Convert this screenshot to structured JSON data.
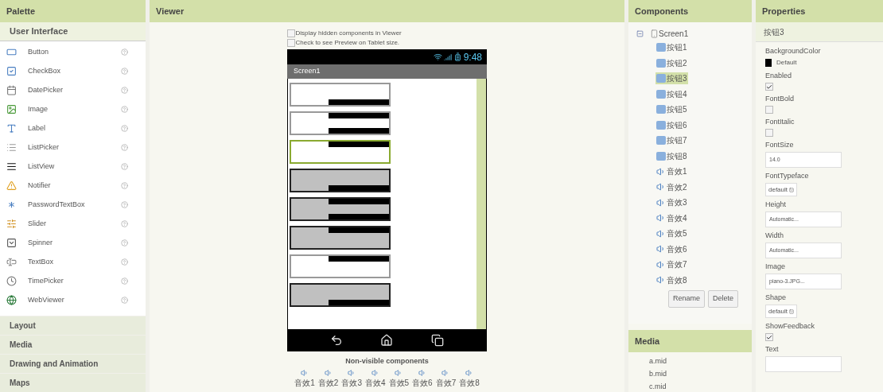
{
  "palette": {
    "title": "Palette",
    "open_section": "User Interface",
    "items": [
      {
        "label": "Button"
      },
      {
        "label": "CheckBox"
      },
      {
        "label": "DatePicker"
      },
      {
        "label": "Image"
      },
      {
        "label": "Label"
      },
      {
        "label": "ListPicker"
      },
      {
        "label": "ListView"
      },
      {
        "label": "Notifier"
      },
      {
        "label": "PasswordTextBox"
      },
      {
        "label": "Slider"
      },
      {
        "label": "Spinner"
      },
      {
        "label": "TextBox"
      },
      {
        "label": "TimePicker"
      },
      {
        "label": "WebViewer"
      }
    ],
    "sections": [
      "Layout",
      "Media",
      "Drawing and Animation",
      "Maps"
    ]
  },
  "viewer": {
    "title": "Viewer",
    "options": [
      {
        "label": "Display hidden components in Viewer",
        "checked": false
      },
      {
        "label": "Check to see Preview on Tablet size.",
        "checked": false
      }
    ],
    "phone": {
      "time": "9:48",
      "screen_title": "Screen1",
      "keys": [
        {
          "kind": "white",
          "top_bar": false,
          "bottom_bar": true,
          "selected": false
        },
        {
          "kind": "white",
          "top_bar": true,
          "bottom_bar": true,
          "selected": false
        },
        {
          "kind": "white",
          "top_bar": true,
          "bottom_bar": false,
          "selected": true
        },
        {
          "kind": "gray",
          "top_bar": false,
          "bottom_bar": true,
          "selected": false
        },
        {
          "kind": "gray",
          "top_bar": true,
          "bottom_bar": true,
          "selected": false
        },
        {
          "kind": "gray",
          "top_bar": true,
          "bottom_bar": false,
          "selected": false
        },
        {
          "kind": "white",
          "top_bar": true,
          "bottom_bar": false,
          "selected": false
        },
        {
          "kind": "gray",
          "top_bar": false,
          "bottom_bar": true,
          "selected": false
        }
      ]
    },
    "nonvisible_title": "Non-visible components",
    "nonvisible": [
      "音效1",
      "音效2",
      "音效3",
      "音效4",
      "音效5",
      "音效6",
      "音效7",
      "音效8"
    ]
  },
  "components": {
    "title": "Components",
    "root": {
      "label": "Screen1",
      "expanded": true,
      "children": [
        {
          "kind": "button",
          "label": "按钮1",
          "selected": false
        },
        {
          "kind": "button",
          "label": "按钮2",
          "selected": false
        },
        {
          "kind": "button",
          "label": "按钮3",
          "selected": true
        },
        {
          "kind": "button",
          "label": "按钮4",
          "selected": false
        },
        {
          "kind": "button",
          "label": "按钮5",
          "selected": false
        },
        {
          "kind": "button",
          "label": "按钮6",
          "selected": false
        },
        {
          "kind": "button",
          "label": "按钮7",
          "selected": false
        },
        {
          "kind": "button",
          "label": "按钮8",
          "selected": false
        },
        {
          "kind": "sound",
          "label": "音效1",
          "selected": false
        },
        {
          "kind": "sound",
          "label": "音效2",
          "selected": false
        },
        {
          "kind": "sound",
          "label": "音效3",
          "selected": false
        },
        {
          "kind": "sound",
          "label": "音效4",
          "selected": false
        },
        {
          "kind": "sound",
          "label": "音效5",
          "selected": false
        },
        {
          "kind": "sound",
          "label": "音效6",
          "selected": false
        },
        {
          "kind": "sound",
          "label": "音效7",
          "selected": false
        },
        {
          "kind": "sound",
          "label": "音效8",
          "selected": false
        }
      ]
    },
    "buttons": [
      "Rename",
      "Delete"
    ]
  },
  "media": {
    "title": "Media",
    "files": [
      "a.mid",
      "b.mid",
      "c.mid"
    ]
  },
  "properties": {
    "title": "Properties",
    "component": "按钮3",
    "items": [
      {
        "kind": "color",
        "label": "BackgroundColor",
        "value": "Default",
        "color": "#000000"
      },
      {
        "kind": "checkbox",
        "label": "Enabled",
        "checked": true
      },
      {
        "kind": "checkbox",
        "label": "FontBold",
        "checked": false
      },
      {
        "kind": "checkbox",
        "label": "FontItalic",
        "checked": false
      },
      {
        "kind": "text",
        "label": "FontSize",
        "value": "14.0"
      },
      {
        "kind": "dropdown",
        "label": "FontTypeface",
        "value": "default"
      },
      {
        "kind": "text",
        "label": "Height",
        "value": "Automatic..."
      },
      {
        "kind": "text",
        "label": "Width",
        "value": "Automatic..."
      },
      {
        "kind": "text",
        "label": "Image",
        "value": "piano-3.JPG..."
      },
      {
        "kind": "dropdown",
        "label": "Shape",
        "value": "default"
      },
      {
        "kind": "checkbox",
        "label": "ShowFeedback",
        "checked": true
      },
      {
        "kind": "text",
        "label": "Text"
      }
    ]
  }
}
